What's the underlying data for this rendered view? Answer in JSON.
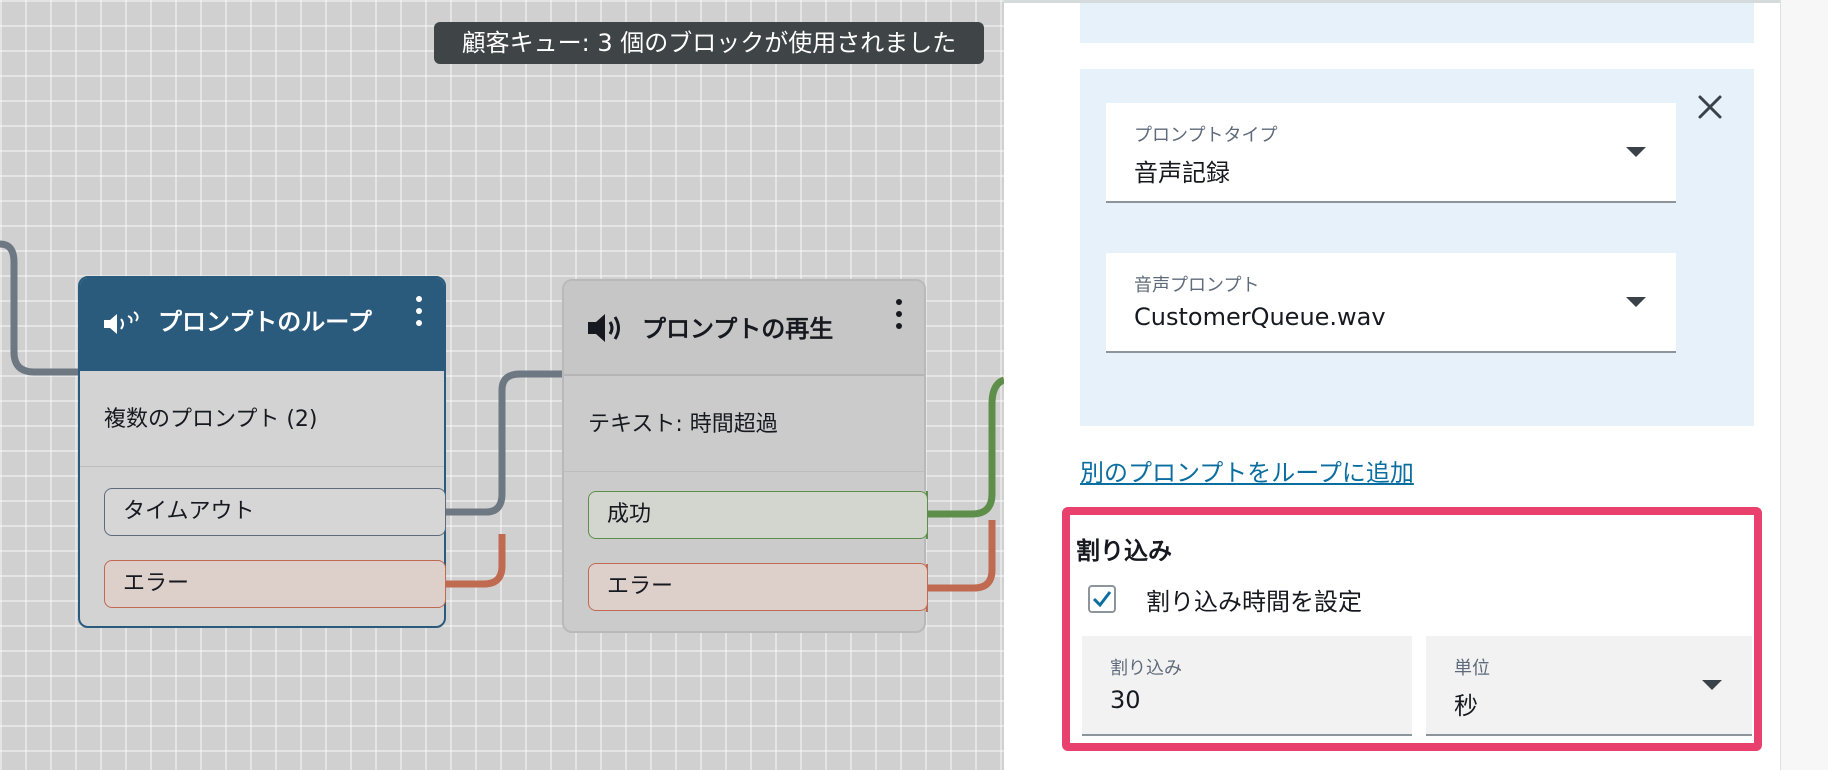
{
  "canvas": {
    "tooltip": "顧客キュー: 3 個のブロックが使用されました",
    "blocks": [
      {
        "title": "プロンプトのループ",
        "icon": "speaker-loop-icon",
        "body": "複数のプロンプト (2)",
        "branches": [
          "タイムアウト",
          "エラー"
        ]
      },
      {
        "title": "プロンプトの再生",
        "icon": "speaker-icon",
        "body": "テキスト: 時間超過",
        "branches": [
          "成功",
          "エラー"
        ]
      }
    ]
  },
  "panel": {
    "prompt_card": {
      "prompt_type": {
        "label": "プロンプトタイプ",
        "value": "音声記録"
      },
      "audio_prompt": {
        "label": "音声プロンプト",
        "value": "CustomerQueue.wav"
      }
    },
    "add_prompt_link": "別のプロンプトをループに追加",
    "barge_in": {
      "title": "割り込み",
      "checkbox_label": "割り込み時間を設定",
      "checked": true,
      "duration": {
        "label": "割り込み",
        "value": "30"
      },
      "unit": {
        "label": "単位",
        "value": "秒"
      }
    }
  },
  "colors": {
    "loop_header": "#2a5a7c",
    "link": "#0b6ea0",
    "highlight": "#e9416e",
    "success": "#5e8f4a",
    "error": "#c06a52",
    "timeout": "#5f6b7a"
  }
}
